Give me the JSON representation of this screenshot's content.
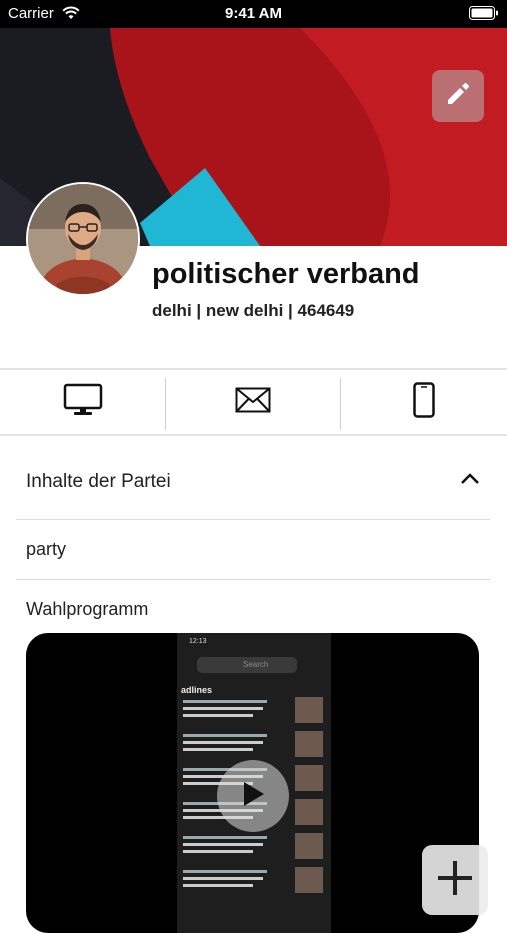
{
  "status_bar": {
    "carrier": "Carrier",
    "time": "9:41 AM"
  },
  "profile": {
    "name": "politischer verband",
    "location": "delhi | new delhi | 464649"
  },
  "contact_actions": [
    {
      "icon": "monitor-icon"
    },
    {
      "icon": "mail-icon"
    },
    {
      "icon": "phone-icon"
    }
  ],
  "section": {
    "title": "Inhalte der Partei",
    "expanded": true
  },
  "items": [
    {
      "label": "party"
    },
    {
      "label": "Wahlprogramm"
    }
  ],
  "video": {
    "phone_time": "12:13",
    "search_placeholder": "Search",
    "headline_label": "adlines"
  },
  "colors": {
    "cover_red": "#b1151c",
    "cover_cyan": "#1fb7d4",
    "cover_dark": "#1b1c22"
  }
}
